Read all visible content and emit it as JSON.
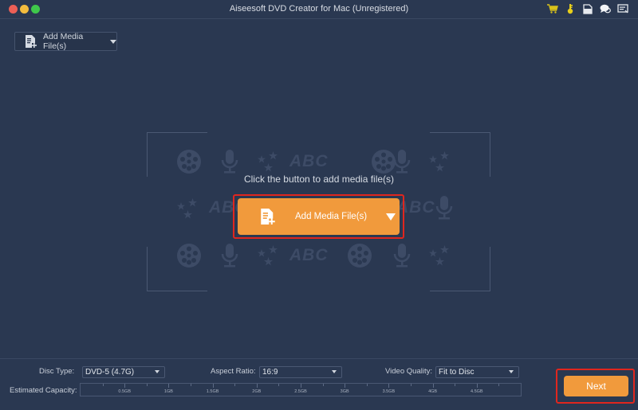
{
  "window": {
    "title": "Aiseesoft DVD Creator for Mac (Unregistered)",
    "toolbar_icons": [
      "cart-icon",
      "key-icon",
      "file-icon",
      "chat-icon",
      "menu-icon"
    ]
  },
  "toolbar": {
    "add_media_label": "Add Media File(s)"
  },
  "drop_area": {
    "hint": "Click the button to add media file(s)",
    "add_media_label": "Add Media File(s)",
    "decor_text": "ABC"
  },
  "settings": {
    "disc_type_label": "Disc Type:",
    "disc_type_value": "DVD-5 (4.7G)",
    "aspect_ratio_label": "Aspect Ratio:",
    "aspect_ratio_value": "16:9",
    "video_quality_label": "Video Quality:",
    "video_quality_value": "Fit to Disc",
    "capacity_label": "Estimated Capacity:",
    "capacity_ticks": [
      "0.5GB",
      "1GB",
      "1.5GB",
      "2GB",
      "2.5GB",
      "3GB",
      "3.5GB",
      "4GB",
      "4.5GB"
    ],
    "capacity_used_fraction": 0
  },
  "actions": {
    "next_label": "Next"
  },
  "colors": {
    "accent": "#f19a3c",
    "highlight": "#e0261e",
    "background": "#2a3851"
  }
}
